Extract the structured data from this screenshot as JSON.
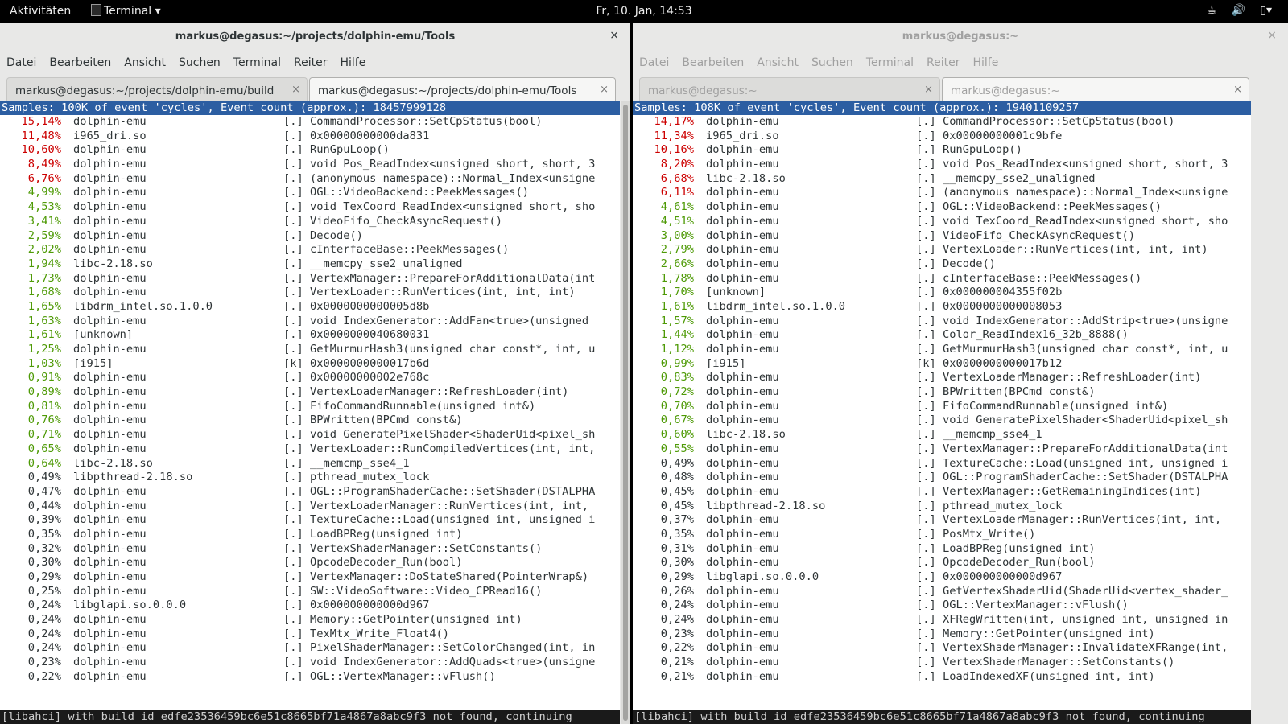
{
  "topbar": {
    "activities": "Aktivitäten",
    "app_name": "Terminal ▾",
    "clock": "Fr, 10. Jan, 14:53",
    "tray_icons": [
      "coffee-cup-icon",
      "volume-icon",
      "battery-icon"
    ],
    "tray_glyphs": [
      "☕",
      "🔊",
      "▯▾"
    ]
  },
  "colors": {
    "high": "#cc0000",
    "medium": "#4e9a06",
    "low": "#2e3436",
    "selection": "#2c5ea2"
  },
  "left": {
    "title": "markus@degasus:~/projects/dolphin-emu/Tools",
    "close": "×",
    "menu": [
      "Datei",
      "Bearbeiten",
      "Ansicht",
      "Suchen",
      "Terminal",
      "Reiter",
      "Hilfe"
    ],
    "tabs": [
      {
        "label": "markus@degasus:~/projects/dolphin-emu/build",
        "close": "×"
      },
      {
        "label": "markus@degasus:~/projects/dolphin-emu/Tools",
        "close": "×"
      }
    ],
    "header": "Samples: 100K of event 'cycles', Event count (approx.): 18457999128",
    "rows": [
      [
        "15,14%",
        "dolphin-emu",
        "[.]",
        "CommandProcessor::SetCpStatus(bool)",
        "high"
      ],
      [
        "11,48%",
        "i965_dri.so",
        "[.]",
        "0x00000000000da831",
        "high"
      ],
      [
        "10,60%",
        "dolphin-emu",
        "[.]",
        "RunGpuLoop()",
        "high"
      ],
      [
        "8,49%",
        "dolphin-emu",
        "[.]",
        "void Pos_ReadIndex<unsigned short, short, 3",
        "high"
      ],
      [
        "6,76%",
        "dolphin-emu",
        "[.]",
        "(anonymous namespace)::Normal_Index<unsigne",
        "high"
      ],
      [
        "4,99%",
        "dolphin-emu",
        "[.]",
        "OGL::VideoBackend::PeekMessages()",
        "medium"
      ],
      [
        "4,53%",
        "dolphin-emu",
        "[.]",
        "void TexCoord_ReadIndex<unsigned short, sho",
        "medium"
      ],
      [
        "3,41%",
        "dolphin-emu",
        "[.]",
        "VideoFifo_CheckAsyncRequest()",
        "medium"
      ],
      [
        "2,59%",
        "dolphin-emu",
        "[.]",
        "Decode()",
        "medium"
      ],
      [
        "2,02%",
        "dolphin-emu",
        "[.]",
        "cInterfaceBase::PeekMessages()",
        "medium"
      ],
      [
        "1,94%",
        "libc-2.18.so",
        "[.]",
        "__memcpy_sse2_unaligned",
        "medium"
      ],
      [
        "1,73%",
        "dolphin-emu",
        "[.]",
        "VertexManager::PrepareForAdditionalData(int",
        "medium"
      ],
      [
        "1,68%",
        "dolphin-emu",
        "[.]",
        "VertexLoader::RunVertices(int, int, int)",
        "medium"
      ],
      [
        "1,65%",
        "libdrm_intel.so.1.0.0",
        "[.]",
        "0x0000000000005d8b",
        "medium"
      ],
      [
        "1,63%",
        "dolphin-emu",
        "[.]",
        "void IndexGenerator::AddFan<true>(unsigned",
        "medium"
      ],
      [
        "1,61%",
        "[unknown]",
        "[.]",
        "0x0000000040680031",
        "medium"
      ],
      [
        "1,25%",
        "dolphin-emu",
        "[.]",
        "GetMurmurHash3(unsigned char const*, int, u",
        "medium"
      ],
      [
        "1,03%",
        "[i915]",
        "[k]",
        "0x0000000000017b6d",
        "medium"
      ],
      [
        "0,91%",
        "dolphin-emu",
        "[.]",
        "0x00000000002e768c",
        "medium"
      ],
      [
        "0,89%",
        "dolphin-emu",
        "[.]",
        "VertexLoaderManager::RefreshLoader(int)",
        "medium"
      ],
      [
        "0,81%",
        "dolphin-emu",
        "[.]",
        "FifoCommandRunnable(unsigned int&)",
        "medium"
      ],
      [
        "0,76%",
        "dolphin-emu",
        "[.]",
        "BPWritten(BPCmd const&)",
        "medium"
      ],
      [
        "0,71%",
        "dolphin-emu",
        "[.]",
        "void GeneratePixelShader<ShaderUid<pixel_sh",
        "medium"
      ],
      [
        "0,65%",
        "dolphin-emu",
        "[.]",
        "VertexLoader::RunCompiledVertices(int, int,",
        "medium"
      ],
      [
        "0,64%",
        "libc-2.18.so",
        "[.]",
        "__memcmp_sse4_1",
        "medium"
      ],
      [
        "0,49%",
        "libpthread-2.18.so",
        "[.]",
        "pthread_mutex_lock",
        "low"
      ],
      [
        "0,47%",
        "dolphin-emu",
        "[.]",
        "OGL::ProgramShaderCache::SetShader(DSTALPHA",
        "low"
      ],
      [
        "0,44%",
        "dolphin-emu",
        "[.]",
        "VertexLoaderManager::RunVertices(int, int,",
        "low"
      ],
      [
        "0,39%",
        "dolphin-emu",
        "[.]",
        "TextureCache::Load(unsigned int, unsigned i",
        "low"
      ],
      [
        "0,35%",
        "dolphin-emu",
        "[.]",
        "LoadBPReg(unsigned int)",
        "low"
      ],
      [
        "0,32%",
        "dolphin-emu",
        "[.]",
        "VertexShaderManager::SetConstants()",
        "low"
      ],
      [
        "0,30%",
        "dolphin-emu",
        "[.]",
        "OpcodeDecoder_Run(bool)",
        "low"
      ],
      [
        "0,29%",
        "dolphin-emu",
        "[.]",
        "VertexManager::DoStateShared(PointerWrap&)",
        "low"
      ],
      [
        "0,25%",
        "dolphin-emu",
        "[.]",
        "SW::VideoSoftware::Video_CPRead16()",
        "low"
      ],
      [
        "0,24%",
        "libglapi.so.0.0.0",
        "[.]",
        "0x000000000000d967",
        "low"
      ],
      [
        "0,24%",
        "dolphin-emu",
        "[.]",
        "Memory::GetPointer(unsigned int)",
        "low"
      ],
      [
        "0,24%",
        "dolphin-emu",
        "[.]",
        "TexMtx_Write_Float4()",
        "low"
      ],
      [
        "0,24%",
        "dolphin-emu",
        "[.]",
        "PixelShaderManager::SetColorChanged(int, in",
        "low"
      ],
      [
        "0,23%",
        "dolphin-emu",
        "[.]",
        "void IndexGenerator::AddQuads<true>(unsigne",
        "low"
      ],
      [
        "0,22%",
        "dolphin-emu",
        "[.]",
        "OGL::VertexManager::vFlush()",
        "low"
      ]
    ],
    "status": "[libahci] with build id edfe23536459bc6e51c8665bf71a4867a8abc9f3 not found, continuing"
  },
  "right": {
    "title": "markus@degasus:~",
    "close": "×",
    "menu": [
      "Datei",
      "Bearbeiten",
      "Ansicht",
      "Suchen",
      "Terminal",
      "Reiter",
      "Hilfe"
    ],
    "tabs": [
      {
        "label": "markus@degasus:~",
        "close": "×"
      },
      {
        "label": "markus@degasus:~",
        "close": "×"
      }
    ],
    "header": "Samples: 108K of event 'cycles', Event count (approx.): 19401109257",
    "rows": [
      [
        "14,17%",
        "dolphin-emu",
        "[.]",
        "CommandProcessor::SetCpStatus(bool)",
        "high"
      ],
      [
        "11,34%",
        "i965_dri.so",
        "[.]",
        "0x00000000001c9bfe",
        "high"
      ],
      [
        "10,16%",
        "dolphin-emu",
        "[.]",
        "RunGpuLoop()",
        "high"
      ],
      [
        "8,20%",
        "dolphin-emu",
        "[.]",
        "void Pos_ReadIndex<unsigned short, short, 3",
        "high"
      ],
      [
        "6,68%",
        "libc-2.18.so",
        "[.]",
        "__memcpy_sse2_unaligned",
        "high"
      ],
      [
        "6,11%",
        "dolphin-emu",
        "[.]",
        "(anonymous namespace)::Normal_Index<unsigne",
        "high"
      ],
      [
        "4,61%",
        "dolphin-emu",
        "[.]",
        "OGL::VideoBackend::PeekMessages()",
        "medium"
      ],
      [
        "4,51%",
        "dolphin-emu",
        "[.]",
        "void TexCoord_ReadIndex<unsigned short, sho",
        "medium"
      ],
      [
        "3,00%",
        "dolphin-emu",
        "[.]",
        "VideoFifo_CheckAsyncRequest()",
        "medium"
      ],
      [
        "2,79%",
        "dolphin-emu",
        "[.]",
        "VertexLoader::RunVertices(int, int, int)",
        "medium"
      ],
      [
        "2,66%",
        "dolphin-emu",
        "[.]",
        "Decode()",
        "medium"
      ],
      [
        "1,78%",
        "dolphin-emu",
        "[.]",
        "cInterfaceBase::PeekMessages()",
        "medium"
      ],
      [
        "1,70%",
        "[unknown]",
        "[.]",
        "0x000000004355f02b",
        "medium"
      ],
      [
        "1,61%",
        "libdrm_intel.so.1.0.0",
        "[.]",
        "0x0000000000008053",
        "medium"
      ],
      [
        "1,57%",
        "dolphin-emu",
        "[.]",
        "void IndexGenerator::AddStrip<true>(unsigne",
        "medium"
      ],
      [
        "1,44%",
        "dolphin-emu",
        "[.]",
        "Color_ReadIndex16_32b_8888()",
        "medium"
      ],
      [
        "1,12%",
        "dolphin-emu",
        "[.]",
        "GetMurmurHash3(unsigned char const*, int, u",
        "medium"
      ],
      [
        "0,99%",
        "[i915]",
        "[k]",
        "0x0000000000017b12",
        "medium"
      ],
      [
        "0,83%",
        "dolphin-emu",
        "[.]",
        "VertexLoaderManager::RefreshLoader(int)",
        "medium"
      ],
      [
        "0,72%",
        "dolphin-emu",
        "[.]",
        "BPWritten(BPCmd const&)",
        "medium"
      ],
      [
        "0,70%",
        "dolphin-emu",
        "[.]",
        "FifoCommandRunnable(unsigned int&)",
        "medium"
      ],
      [
        "0,67%",
        "dolphin-emu",
        "[.]",
        "void GeneratePixelShader<ShaderUid<pixel_sh",
        "medium"
      ],
      [
        "0,60%",
        "libc-2.18.so",
        "[.]",
        "__memcmp_sse4_1",
        "medium"
      ],
      [
        "0,55%",
        "dolphin-emu",
        "[.]",
        "VertexManager::PrepareForAdditionalData(int",
        "medium"
      ],
      [
        "0,49%",
        "dolphin-emu",
        "[.]",
        "TextureCache::Load(unsigned int, unsigned i",
        "low"
      ],
      [
        "0,48%",
        "dolphin-emu",
        "[.]",
        "OGL::ProgramShaderCache::SetShader(DSTALPHA",
        "low"
      ],
      [
        "0,45%",
        "dolphin-emu",
        "[.]",
        "VertexManager::GetRemainingIndices(int)",
        "low"
      ],
      [
        "0,45%",
        "libpthread-2.18.so",
        "[.]",
        "pthread_mutex_lock",
        "low"
      ],
      [
        "0,37%",
        "dolphin-emu",
        "[.]",
        "VertexLoaderManager::RunVertices(int, int,",
        "low"
      ],
      [
        "0,35%",
        "dolphin-emu",
        "[.]",
        "PosMtx_Write()",
        "low"
      ],
      [
        "0,31%",
        "dolphin-emu",
        "[.]",
        "LoadBPReg(unsigned int)",
        "low"
      ],
      [
        "0,30%",
        "dolphin-emu",
        "[.]",
        "OpcodeDecoder_Run(bool)",
        "low"
      ],
      [
        "0,29%",
        "libglapi.so.0.0.0",
        "[.]",
        "0x000000000000d967",
        "low"
      ],
      [
        "0,26%",
        "dolphin-emu",
        "[.]",
        "GetVertexShaderUid(ShaderUid<vertex_shader_",
        "low"
      ],
      [
        "0,24%",
        "dolphin-emu",
        "[.]",
        "OGL::VertexManager::vFlush()",
        "low"
      ],
      [
        "0,24%",
        "dolphin-emu",
        "[.]",
        "XFRegWritten(int, unsigned int, unsigned in",
        "low"
      ],
      [
        "0,23%",
        "dolphin-emu",
        "[.]",
        "Memory::GetPointer(unsigned int)",
        "low"
      ],
      [
        "0,22%",
        "dolphin-emu",
        "[.]",
        "VertexShaderManager::InvalidateXFRange(int,",
        "low"
      ],
      [
        "0,21%",
        "dolphin-emu",
        "[.]",
        "VertexShaderManager::SetConstants()",
        "low"
      ],
      [
        "0,21%",
        "dolphin-emu",
        "[.]",
        "LoadIndexedXF(unsigned int, int)",
        "low"
      ]
    ],
    "status": "[libahci] with build id edfe23536459bc6e51c8665bf71a4867a8abc9f3 not found, continuing"
  }
}
